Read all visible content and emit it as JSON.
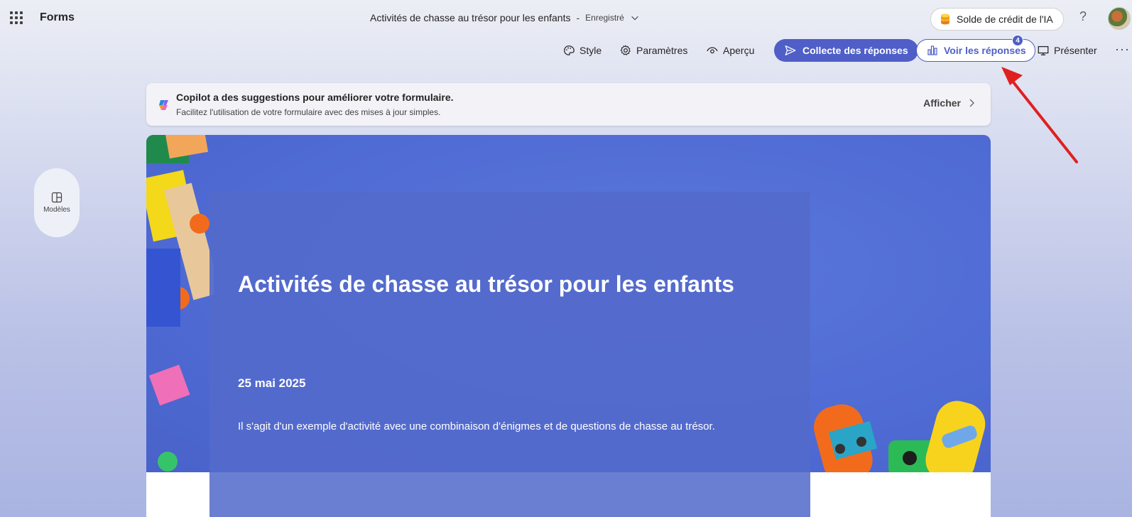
{
  "app": {
    "name": "Forms"
  },
  "document": {
    "title": "Activités de chasse au trésor pour les enfants",
    "separator": "-",
    "status": "Enregistré"
  },
  "header": {
    "credit_label": "Solde de crédit de l'IA",
    "help_label": "?"
  },
  "toolbar": {
    "style_label": "Style",
    "settings_label": "Paramètres",
    "preview_label": "Aperçu",
    "collect_label": "Collecte des réponses",
    "view_responses_label": "Voir les réponses",
    "responses_count": "4",
    "present_label": "Présenter",
    "more_label": "···"
  },
  "copilot": {
    "title": "Copilot a des suggestions pour améliorer votre formulaire.",
    "subtitle": "Facilitez l'utilisation de votre formulaire avec des mises à jour simples.",
    "action_label": "Afficher"
  },
  "sidebar": {
    "templates_label": "Modèles"
  },
  "form": {
    "title": "Activités de chasse au trésor pour les enfants",
    "date": "25 mai 2025",
    "description": "Il s'agit d'un exemple d'activité avec une combinaison d'énigmes et de questions de chasse au trésor."
  },
  "colors": {
    "accent": "#4f5fc7",
    "banner": "#4f6bd4",
    "annotation_arrow": "#e02020"
  },
  "icons": [
    "waffle-icon",
    "chevron-down-icon",
    "coin-stack-icon",
    "help-icon",
    "palette-icon",
    "gear-icon",
    "eye-icon",
    "send-icon",
    "bar-chart-icon",
    "present-icon",
    "more-icon",
    "copilot-icon",
    "chevron-right-icon",
    "templates-icon"
  ]
}
